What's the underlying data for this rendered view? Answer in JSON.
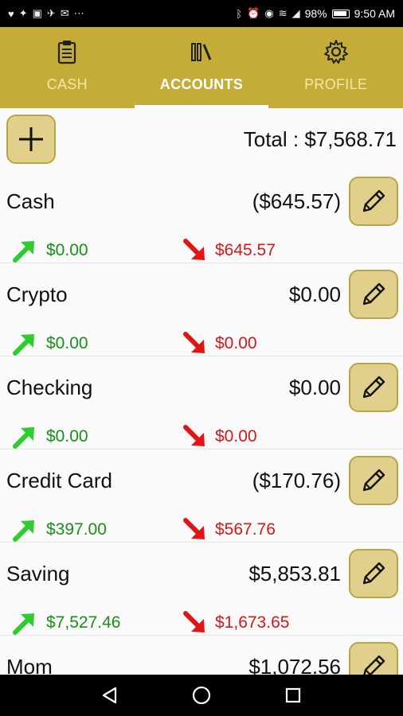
{
  "status": {
    "battery": "98%",
    "time": "9:50 AM",
    "left_icons": [
      "heart-icon",
      "gamepad-icon",
      "image-icon",
      "twitter-icon",
      "mail-icon",
      "more-icon"
    ],
    "right_icons": [
      "bluetooth-icon",
      "alarm-icon",
      "eye-icon",
      "wifi-icon",
      "signal-icon",
      "battery-icon"
    ]
  },
  "tabs": [
    {
      "label": "CASH",
      "icon": "clipboard-icon",
      "active": false
    },
    {
      "label": "ACCOUNTS",
      "icon": "books-icon",
      "active": true
    },
    {
      "label": "PROFILE",
      "icon": "gear-icon",
      "active": false
    }
  ],
  "header": {
    "total": "Total : $7,568.71",
    "add_icon": "plus-icon"
  },
  "accounts": [
    {
      "name": "Cash",
      "balance": "($645.57)",
      "inflow": "$0.00",
      "outflow": "$645.57"
    },
    {
      "name": "Crypto",
      "balance": "$0.00",
      "inflow": "$0.00",
      "outflow": "$0.00"
    },
    {
      "name": "Checking",
      "balance": "$0.00",
      "inflow": "$0.00",
      "outflow": "$0.00"
    },
    {
      "name": "Credit Card",
      "balance": "($170.76)",
      "inflow": "$397.00",
      "outflow": "$567.76"
    },
    {
      "name": "Saving",
      "balance": "$5,853.81",
      "inflow": "$7,527.46",
      "outflow": "$1,673.65"
    },
    {
      "name": "Mom",
      "balance": "$1,072.56",
      "inflow": "",
      "outflow": ""
    }
  ],
  "colors": {
    "accent": "#c3ad38",
    "button_fill": "#e0d08c",
    "income": "#1a8e1a",
    "expense": "#d21919"
  },
  "nav": [
    "back-icon",
    "home-icon",
    "recents-icon"
  ]
}
